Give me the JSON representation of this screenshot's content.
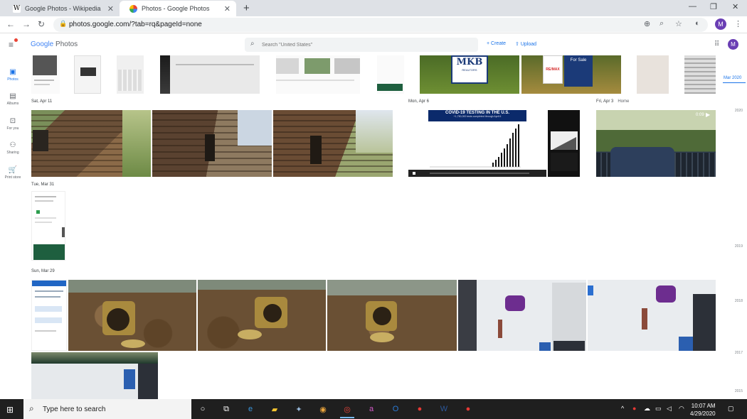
{
  "browser": {
    "tabs": [
      {
        "title": "Google Photos - Wikipedia",
        "icon": "wikipedia-icon"
      },
      {
        "title": "Photos - Google Photos",
        "icon": "google-photos-icon"
      }
    ],
    "url": "photos.google.com/?tab=rq&pageId=none",
    "profile_initial": "M"
  },
  "app": {
    "logo_google": "Google",
    "logo_photos": "Photos",
    "search_placeholder": "Search \"United States\"",
    "create_label": "Create",
    "upload_label": "Upload",
    "profile_initial": "M"
  },
  "sidebar": [
    {
      "label": "Photos",
      "icon": "photos-icon",
      "active": true
    },
    {
      "label": "Albums",
      "icon": "albums-icon",
      "active": false
    },
    {
      "label": "For you",
      "icon": "for-you-icon",
      "active": false
    },
    {
      "label": "Sharing",
      "icon": "sharing-icon",
      "active": false
    },
    {
      "label": "Print store",
      "icon": "print-store-icon",
      "active": false
    }
  ],
  "date_groups": [
    {
      "date": "Sat, Apr 11",
      "location": ""
    },
    {
      "date": "Mon, Apr 6",
      "location": ""
    },
    {
      "date": "Fri, Apr 3",
      "location": "Home"
    },
    {
      "date": "Tue, Mar 31",
      "location": ""
    },
    {
      "date": "Sun, Mar 29",
      "location": ""
    }
  ],
  "photo_text": {
    "mkb": "MKB",
    "mkb_sub": "REALTORS",
    "remax": "RE/MAX",
    "for_sale": "For Sale",
    "covid_title": "COVID-19 TESTING IN THE U.S.",
    "covid_sub": "+1,750,000 tests completed through April 6",
    "video_duration": "0:09"
  },
  "timeline": {
    "current": "Mar 2020",
    "years": [
      "2020",
      "2019",
      "2018",
      "2017",
      "2015"
    ]
  },
  "taskbar": {
    "search_placeholder": "Type here to search",
    "time": "10:07 AM",
    "date": "4/29/2020"
  }
}
